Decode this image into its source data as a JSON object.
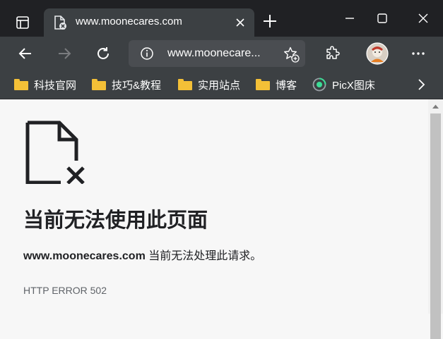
{
  "browser": {
    "tab": {
      "title": "www.moonecares.com"
    },
    "window_controls": {
      "minimize": "minimize",
      "maximize": "maximize",
      "close": "close"
    },
    "address_bar": {
      "value": "www.moonecare..."
    },
    "bookmarks": [
      {
        "label": "科技官网",
        "icon": "folder-icon"
      },
      {
        "label": "技巧&教程",
        "icon": "folder-icon"
      },
      {
        "label": "实用站点",
        "icon": "folder-icon"
      },
      {
        "label": "博客",
        "icon": "folder-icon"
      },
      {
        "label": "PicX图床",
        "icon": "picx-icon"
      }
    ]
  },
  "error_page": {
    "title": "当前无法使用此页面",
    "domain": "www.moonecares.com",
    "message": "当前无法处理此请求。",
    "code": "HTTP ERROR 502"
  },
  "colors": {
    "titlebar": "#202124",
    "toolbar": "#3c4043",
    "folder": "#f4c037",
    "page_bg": "#f7f7f7"
  }
}
